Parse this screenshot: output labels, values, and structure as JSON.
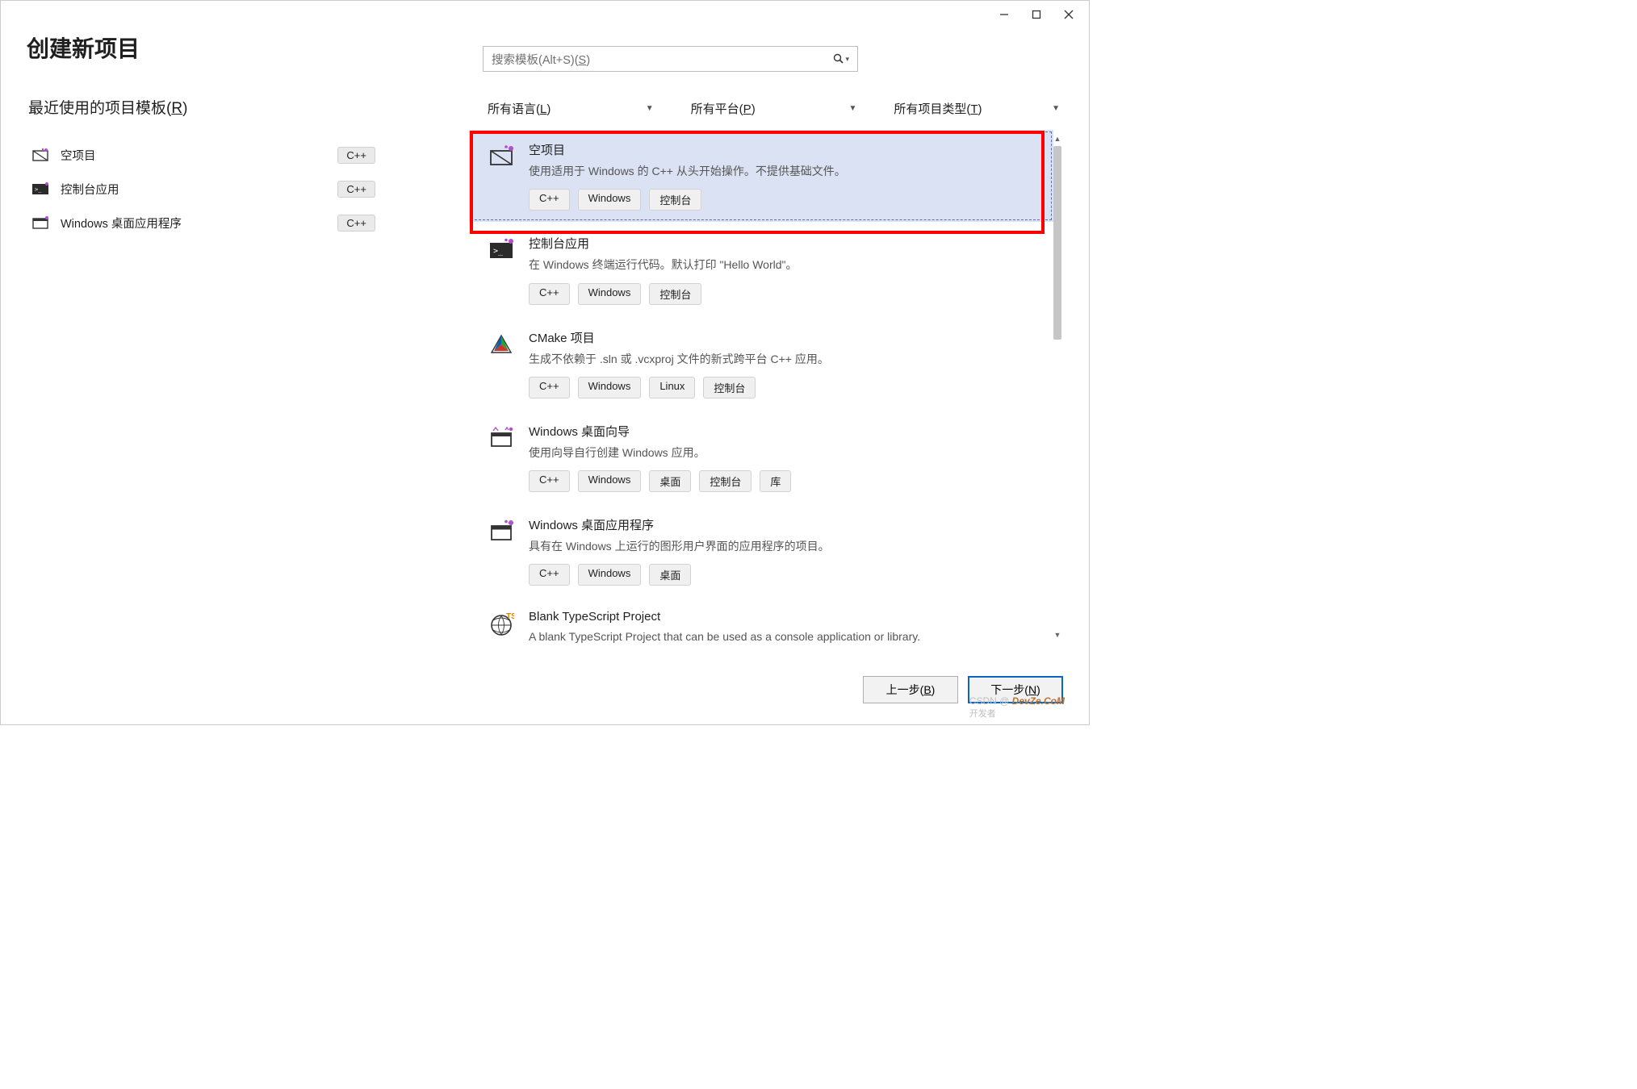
{
  "window": {
    "title": "创建新项目"
  },
  "recent": {
    "heading_pre": "最近使用的项目模板(",
    "heading_u": "R",
    "heading_post": ")",
    "items": [
      {
        "name": "空项目",
        "badge": "C++",
        "icon": "empty-project"
      },
      {
        "name": "控制台应用",
        "badge": "C++",
        "icon": "console"
      },
      {
        "name": "Windows 桌面应用程序",
        "badge": "C++",
        "icon": "desktop-app"
      }
    ]
  },
  "search": {
    "placeholder_pre": "搜索模板(Alt+S)(",
    "placeholder_u": "S",
    "placeholder_post": ")"
  },
  "filters": {
    "language": {
      "pre": "所有语言(",
      "u": "L",
      "post": ")"
    },
    "platform": {
      "pre": "所有平台(",
      "u": "P",
      "post": ")"
    },
    "projtype": {
      "pre": "所有项目类型(",
      "u": "T",
      "post": ")"
    }
  },
  "templates": [
    {
      "title": "空项目",
      "desc": "使用适用于 Windows 的 C++ 从头开始操作。不提供基础文件。",
      "tags": [
        "C++",
        "Windows",
        "控制台"
      ],
      "icon": "empty-project",
      "selected": true
    },
    {
      "title": "控制台应用",
      "desc": "在 Windows 终端运行代码。默认打印 \"Hello World\"。",
      "tags": [
        "C++",
        "Windows",
        "控制台"
      ],
      "icon": "console"
    },
    {
      "title": "CMake 项目",
      "desc": "生成不依赖于 .sln 或 .vcxproj 文件的新式跨平台 C++ 应用。",
      "tags": [
        "C++",
        "Windows",
        "Linux",
        "控制台"
      ],
      "icon": "cmake"
    },
    {
      "title": "Windows 桌面向导",
      "desc": "使用向导自行创建 Windows 应用。",
      "tags": [
        "C++",
        "Windows",
        "桌面",
        "控制台",
        "库"
      ],
      "icon": "desktop-wizard"
    },
    {
      "title": "Windows 桌面应用程序",
      "desc": "具有在 Windows 上运行的图形用户界面的应用程序的项目。",
      "tags": [
        "C++",
        "Windows",
        "桌面"
      ],
      "icon": "desktop-app"
    },
    {
      "title": "Blank TypeScript Project",
      "desc": "A blank TypeScript Project that can be used as a console application or library.",
      "tags": [],
      "icon": "typescript"
    }
  ],
  "buttons": {
    "back_pre": "上一步(",
    "back_u": "B",
    "back_post": ")",
    "next_pre": "下一步(",
    "next_u": "N",
    "next_post": ")"
  },
  "watermark": {
    "csdn": "CSDN @ ",
    "dev": "DevZe.CoM",
    "sub": "开发者"
  }
}
